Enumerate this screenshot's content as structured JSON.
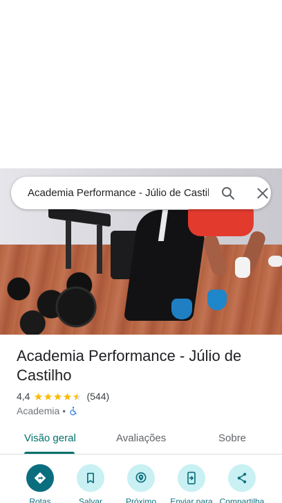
{
  "search": {
    "query": "Academia Performance - Júlio de Castilho"
  },
  "place": {
    "title": "Academia Performance - Júlio de Castilho",
    "rating": "4,4",
    "rating_stars": 4.4,
    "review_count": "(544)",
    "category": "Academia",
    "separator": "•"
  },
  "tabs": [
    {
      "label": "Visão geral",
      "selected": true
    },
    {
      "label": "Avaliações",
      "selected": false
    },
    {
      "label": "Sobre",
      "selected": false
    }
  ],
  "actions": [
    {
      "label": "Rotas",
      "icon": "directions-icon"
    },
    {
      "label": "Salvar",
      "icon": "bookmark-icon"
    },
    {
      "label": "Próximo",
      "icon": "nearby-icon"
    },
    {
      "label": "Enviar para",
      "icon": "send-to-phone-icon"
    },
    {
      "label": "Compartilha",
      "icon": "share-icon"
    }
  ],
  "colors": {
    "accent": "#00706b",
    "action_bg": "#c9f0f3",
    "star": "#fbbc04"
  }
}
